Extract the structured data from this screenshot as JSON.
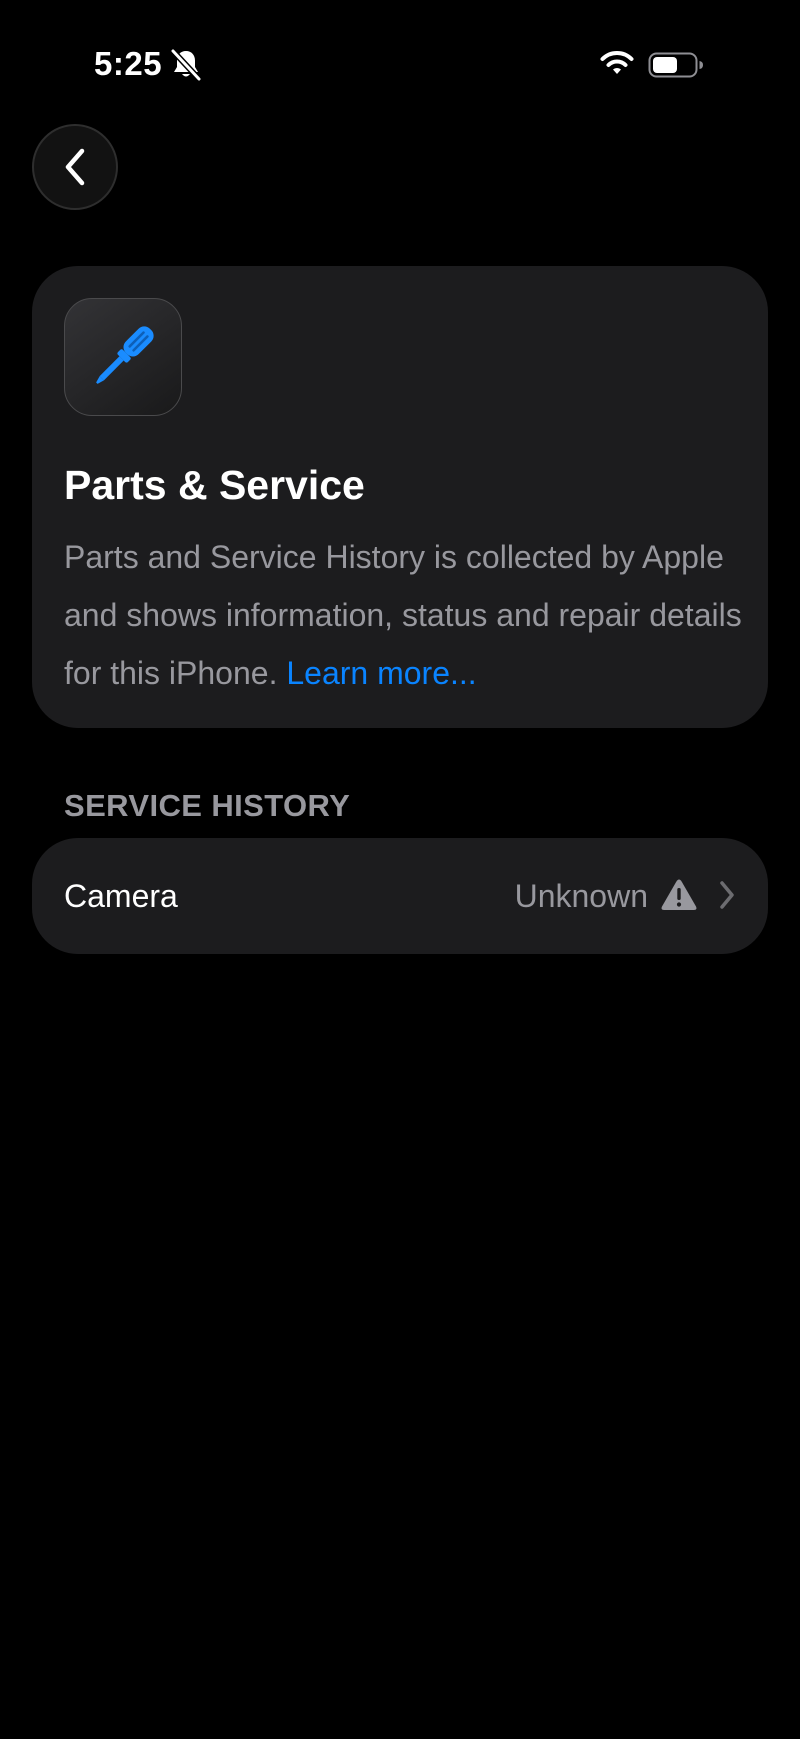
{
  "status_bar": {
    "time": "5:25",
    "icons": [
      "bell-slash-icon",
      "wifi-icon",
      "battery-icon"
    ]
  },
  "navigation": {
    "back_icon": "chevron-left-icon"
  },
  "info_card": {
    "icon": "screwdriver-icon",
    "title": "Parts & Service",
    "description": "Parts and Service History is collected by Apple and shows information, status and repair details for this iPhone.",
    "learn_more": "Learn more..."
  },
  "service_history": {
    "header": "SERVICE HISTORY",
    "items": [
      {
        "label": "Camera",
        "value": "Unknown",
        "status_icon": "warning-icon",
        "accessory_icon": "chevron-right-icon"
      }
    ]
  },
  "colors": {
    "background": "#000000",
    "card": "#1c1c1e",
    "secondary_text": "#98989e",
    "link": "#0a84ff",
    "icon_blue": "#1a8cff"
  }
}
